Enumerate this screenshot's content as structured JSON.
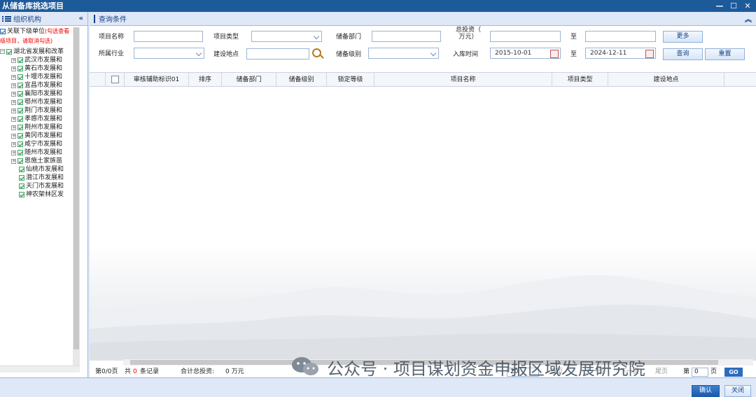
{
  "window": {
    "title": "从储备库挑选项目",
    "controls": [
      "—",
      "☐",
      "✕"
    ]
  },
  "left_panel": {
    "title": "组织机构",
    "collapse_label": "«",
    "include_sub_label": "关联下级单位",
    "include_sub_note": "(勾选查看",
    "hint": "级项目，请取消勾选)",
    "root": "湖北省发展和改革",
    "items": [
      {
        "label": "武汉市发展和",
        "expandable": true
      },
      {
        "label": "黄石市发展和",
        "expandable": true
      },
      {
        "label": "十堰市发展和",
        "expandable": true
      },
      {
        "label": "宜昌市发展和",
        "expandable": true
      },
      {
        "label": "襄阳市发展和",
        "expandable": true
      },
      {
        "label": "鄂州市发展和",
        "expandable": true
      },
      {
        "label": "荆门市发展和",
        "expandable": true
      },
      {
        "label": "孝感市发展和",
        "expandable": true
      },
      {
        "label": "荆州市发展和",
        "expandable": true
      },
      {
        "label": "黄冈市发展和",
        "expandable": true
      },
      {
        "label": "咸宁市发展和",
        "expandable": true
      },
      {
        "label": "随州市发展和",
        "expandable": true
      },
      {
        "label": "恩施土家族苗",
        "expandable": true
      },
      {
        "label": "仙桃市发展和",
        "expandable": false
      },
      {
        "label": "潜江市发展和",
        "expandable": false
      },
      {
        "label": "天门市发展和",
        "expandable": false
      },
      {
        "label": "神农架林区发",
        "expandable": false
      }
    ]
  },
  "query": {
    "title": "查询条件",
    "fields": {
      "project_name": {
        "label": "项目名称",
        "value": ""
      },
      "project_type": {
        "label": "项目类型",
        "value": ""
      },
      "reserve_dept": {
        "label": "储备部门",
        "value": ""
      },
      "total_invest": {
        "label": "总投资（万元）",
        "label_l1": "总投资（",
        "label_l2": "万元）",
        "from": "",
        "to_label": "至",
        "to": ""
      },
      "industry": {
        "label": "所属行业",
        "value": ""
      },
      "location": {
        "label": "建设地点",
        "value": ""
      },
      "reserve_level": {
        "label": "储备级别",
        "value": ""
      },
      "entry_time": {
        "label": "入库时间",
        "from": "2015-10-01",
        "to_label": "至",
        "to": "2024-12-11"
      }
    },
    "buttons": {
      "more": "更多",
      "search": "查询",
      "reset": "重置"
    }
  },
  "grid": {
    "columns": [
      "审核辅助标识01",
      "排序",
      "储备部门",
      "储备级别",
      "锁定等级",
      "项目名称",
      "项目类型",
      "建设地点"
    ],
    "rows": []
  },
  "pager": {
    "page_info": "第0/0页",
    "total_prefix": "共",
    "total_count": "0",
    "total_suffix": "条记录",
    "invest_label": "合计总投资:",
    "invest_value": "0 万元",
    "page_size": "20",
    "first": "首页",
    "prev": "上一页",
    "next": "下一页",
    "last": "尾页",
    "goto_prefix": "第",
    "goto_value": "0",
    "goto_suffix": "页",
    "go": "GO"
  },
  "footer": {
    "confirm": "确认",
    "close": "关闭"
  },
  "watermark": "公众号 · 项目谋划资金申报区域发展研究院"
}
